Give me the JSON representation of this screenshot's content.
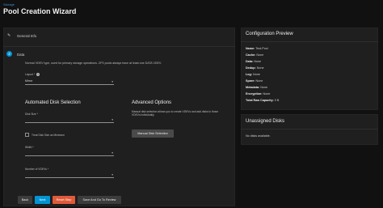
{
  "breadcrumb": "Storage",
  "page_title": "Pool Creation Wizard",
  "steps": [
    {
      "label": "General Info"
    },
    {
      "number": "2",
      "label": "Data"
    }
  ],
  "data_step": {
    "intro": "Normal VDEV type, used for primary storage operations. ZFS pools always have at least one DATA VDEV.",
    "layout_label": "Layout *",
    "layout_value": "Mirror",
    "automated": {
      "title": "Automated Disk Selection",
      "disk_size_label": "Disk Size *",
      "disk_size_value": "",
      "treat_as_minimum_label": "Treat Disk Size as Minimum",
      "width_label": "Width *",
      "width_value": "",
      "num_vdevs_label": "Number of VDEVs *",
      "num_vdevs_value": ""
    },
    "advanced": {
      "title": "Advanced Options",
      "description": "Manual disk selection allows you to create VDEVs and add disks to those VDEVs individually.",
      "manual_button": "Manual Disk Selection"
    }
  },
  "buttons": {
    "back": "Back",
    "next": "Next",
    "reset": "Reset Step",
    "save_review": "Save And Go To Review"
  },
  "config_preview": {
    "title": "Configuration Preview",
    "rows": [
      {
        "label": "Name:",
        "value": "Test-Pool"
      },
      {
        "label": "Cache:",
        "value": "None"
      },
      {
        "label": "Data:",
        "value": "None"
      },
      {
        "label": "Dedup:",
        "value": "None"
      },
      {
        "label": "Log:",
        "value": "None"
      },
      {
        "label": "Spare:",
        "value": "None"
      },
      {
        "label": "Metadata:",
        "value": "None"
      },
      {
        "label": "Encryption:",
        "value": "None"
      },
      {
        "label": "Total Raw Capacity:",
        "value": "0 B"
      }
    ]
  },
  "unassigned": {
    "title": "Unassigned Disks",
    "empty_text": "No disks available."
  },
  "colors": {
    "accent": "#0095d5",
    "reset": "#e05a3a",
    "panel": "#1f1f1f",
    "background": "#111111"
  }
}
